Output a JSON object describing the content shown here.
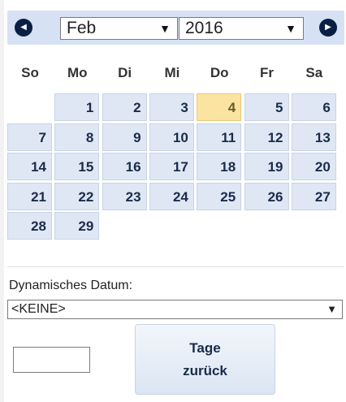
{
  "header": {
    "prev_icon": "chevron-left",
    "next_icon": "chevron-right",
    "month": "Feb",
    "year": "2016",
    "dropdown_arrow": "▼"
  },
  "weekdays": [
    "So",
    "Mo",
    "Di",
    "Mi",
    "Do",
    "Fr",
    "Sa"
  ],
  "days": [
    {
      "label": "1",
      "col": 1,
      "row": 0
    },
    {
      "label": "2",
      "col": 2,
      "row": 0
    },
    {
      "label": "3",
      "col": 3,
      "row": 0
    },
    {
      "label": "4",
      "col": 4,
      "row": 0,
      "today": true
    },
    {
      "label": "5",
      "col": 5,
      "row": 0
    },
    {
      "label": "6",
      "col": 6,
      "row": 0
    },
    {
      "label": "7",
      "col": 0,
      "row": 1
    },
    {
      "label": "8",
      "col": 1,
      "row": 1
    },
    {
      "label": "9",
      "col": 2,
      "row": 1
    },
    {
      "label": "10",
      "col": 3,
      "row": 1
    },
    {
      "label": "11",
      "col": 4,
      "row": 1
    },
    {
      "label": "12",
      "col": 5,
      "row": 1
    },
    {
      "label": "13",
      "col": 6,
      "row": 1
    },
    {
      "label": "14",
      "col": 0,
      "row": 2
    },
    {
      "label": "15",
      "col": 1,
      "row": 2
    },
    {
      "label": "16",
      "col": 2,
      "row": 2
    },
    {
      "label": "17",
      "col": 3,
      "row": 2
    },
    {
      "label": "18",
      "col": 4,
      "row": 2
    },
    {
      "label": "19",
      "col": 5,
      "row": 2
    },
    {
      "label": "20",
      "col": 6,
      "row": 2
    },
    {
      "label": "21",
      "col": 0,
      "row": 3
    },
    {
      "label": "22",
      "col": 1,
      "row": 3
    },
    {
      "label": "23",
      "col": 2,
      "row": 3
    },
    {
      "label": "24",
      "col": 3,
      "row": 3
    },
    {
      "label": "25",
      "col": 4,
      "row": 3
    },
    {
      "label": "26",
      "col": 5,
      "row": 3
    },
    {
      "label": "27",
      "col": 6,
      "row": 3
    },
    {
      "label": "28",
      "col": 0,
      "row": 4
    },
    {
      "label": "29",
      "col": 1,
      "row": 4
    }
  ],
  "dynamic_date": {
    "label": "Dynamisches Datum:",
    "selected": "<KEINE>"
  },
  "days_back": {
    "value": "",
    "button_line1": "Tage",
    "button_line2": "zurück"
  },
  "colors": {
    "header_bg": "#d6e2f4",
    "day_bg": "#dfe7f4",
    "today_bg": "#fbe3a2",
    "nav_icon": "#0a1f44"
  }
}
